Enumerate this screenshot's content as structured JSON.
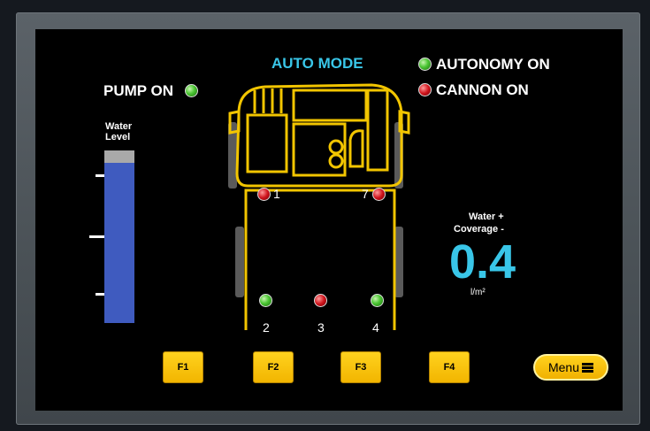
{
  "status": {
    "mode_label": "AUTO MODE",
    "pump_label": "PUMP ON",
    "autonomy_label": "AUTONOMY ON",
    "cannon_label": "CANNON ON"
  },
  "water_level": {
    "label_line1": "Water",
    "label_line2": "Level",
    "fill_fraction": 0.93
  },
  "coverage": {
    "label_line1": "Water +",
    "label_line2": "Coverage -",
    "value": "0.4",
    "unit": "l/m²"
  },
  "nozzles": [
    {
      "id": "1",
      "state": "red"
    },
    {
      "id": "7",
      "state": "red"
    },
    {
      "id": "2",
      "state": "green"
    },
    {
      "id": "3",
      "state": "red"
    },
    {
      "id": "4",
      "state": "green"
    }
  ],
  "function_buttons": [
    "F1",
    "F2",
    "F3",
    "F4"
  ],
  "menu": {
    "label": "Menu"
  },
  "colors": {
    "accent_cyan": "#39c6e8",
    "button_yellow": "#ffd21e",
    "truck_outline": "#f2c500",
    "led_green": "#4bc633",
    "led_red": "#d0141c",
    "tank_blue": "#3f5bbf"
  }
}
